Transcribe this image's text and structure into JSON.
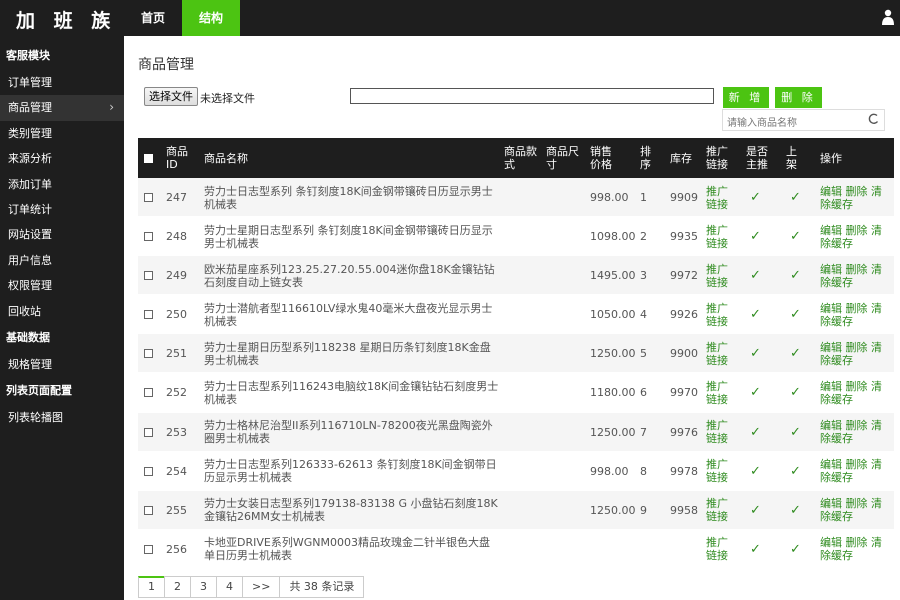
{
  "app": {
    "logo": "加 班 族"
  },
  "topnav": [
    {
      "label": "首页",
      "active": false
    },
    {
      "label": "结构",
      "active": true
    }
  ],
  "sidebar": {
    "sections": [
      {
        "title": "客服模块",
        "items": [
          {
            "label": "订单管理",
            "active": false
          },
          {
            "label": "商品管理",
            "active": true
          },
          {
            "label": "类别管理",
            "active": false
          },
          {
            "label": "来源分析",
            "active": false
          },
          {
            "label": "添加订单",
            "active": false
          },
          {
            "label": "订单统计",
            "active": false
          },
          {
            "label": "网站设置",
            "active": false
          },
          {
            "label": "用户信息",
            "active": false
          },
          {
            "label": "权限管理",
            "active": false
          },
          {
            "label": "回收站",
            "active": false
          }
        ]
      },
      {
        "title": "基础数据",
        "items": [
          {
            "label": "规格管理",
            "active": false
          }
        ]
      },
      {
        "title": "列表页面配置",
        "items": [
          {
            "label": "列表轮播图",
            "active": false
          }
        ]
      }
    ],
    "active_chevron": "›"
  },
  "main": {
    "title": "商品管理",
    "file_button": "选择文件",
    "file_status": "未选择文件",
    "add_button": "新 增",
    "delete_button": "删 除",
    "search_placeholder": "请输入商品名称"
  },
  "table": {
    "headers": {
      "id": "商品ID",
      "name": "商品名称",
      "style": "商品款式",
      "size": "商品尺寸",
      "price": "销售价格",
      "sort": "排序",
      "stock": "库存",
      "link": "推广链接",
      "main": "是否主推",
      "shelf": "上架",
      "ops": "操作"
    },
    "link_label": "推广链接",
    "ops_label": "编辑 删除 清除缓存",
    "check_mark": "✓",
    "rows": [
      {
        "id": "247",
        "name": "劳力士日志型系列 条钉刻度18K间金钢带镶砖日历显示男士机械表",
        "price": "998.00",
        "sort": "1",
        "stock": "9909"
      },
      {
        "id": "248",
        "name": "劳力士星期日志型系列 条钉刻度18K间金钢带镶砖日历显示男士机械表",
        "price": "1098.00",
        "sort": "2",
        "stock": "9935"
      },
      {
        "id": "249",
        "name": "欧米茄星座系列123.25.27.20.55.004迷你盘18K金镶钻钻石刻度自动上链女表",
        "price": "1495.00",
        "sort": "3",
        "stock": "9972"
      },
      {
        "id": "250",
        "name": "劳力士潜航者型116610LV绿水鬼40毫米大盘夜光显示男士机械表",
        "price": "1050.00",
        "sort": "4",
        "stock": "9926"
      },
      {
        "id": "251",
        "name": "劳力士星期日历型系列118238 星期日历条钉刻度18K金盘男士机械表",
        "price": "1250.00",
        "sort": "5",
        "stock": "9900"
      },
      {
        "id": "252",
        "name": "劳力士日志型系列116243电脑纹18K间金镶钻钻石刻度男士机械表",
        "price": "1180.00",
        "sort": "6",
        "stock": "9970"
      },
      {
        "id": "253",
        "name": "劳力士格林尼治型II系列116710LN-78200夜光黑盘陶瓷外圈男士机械表",
        "price": "1250.00",
        "sort": "7",
        "stock": "9976"
      },
      {
        "id": "254",
        "name": "劳力士日志型系列126333-62613 条钉刻度18K间金钢带日历显示男士机械表",
        "price": "998.00",
        "sort": "8",
        "stock": "9978"
      },
      {
        "id": "255",
        "name": "劳力士女装日志型系列179138-83138 G 小盘钻石刻度18K金镶钻26MM女士机械表",
        "price": "1250.00",
        "sort": "9",
        "stock": "9958"
      },
      {
        "id": "256",
        "name": "卡地亚DRIVE系列WGNM0003精品玫瑰金二针半银色大盘单日历男士机械表",
        "price": "",
        "sort": "",
        "stock": ""
      }
    ]
  },
  "pagination": {
    "pages": [
      "1",
      "2",
      "3",
      "4",
      ">>"
    ],
    "active": "1",
    "total": "共 38 条记录"
  },
  "colors": {
    "accent": "#4cc412",
    "dark": "#1e1e1e",
    "link": "#2e8b1e"
  },
  "icons": {
    "user": "user-icon",
    "search": "search-icon",
    "check": "check-icon"
  }
}
